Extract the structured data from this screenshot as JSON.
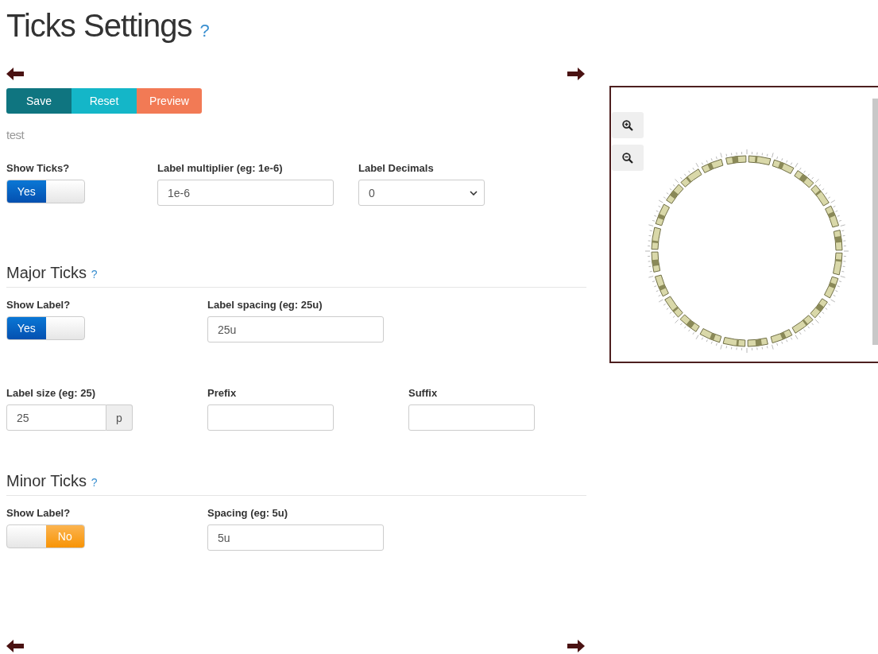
{
  "title": "Ticks Settings",
  "title_help": "?",
  "buttons": [
    {
      "label": "Save",
      "kind": "save"
    },
    {
      "label": "Reset",
      "kind": "reset"
    },
    {
      "label": "Preview",
      "kind": "preview"
    }
  ],
  "note": "test",
  "general": [
    {
      "kind": "toggle",
      "label": "Show Ticks?",
      "on": true,
      "text": "Yes"
    },
    {
      "kind": "input",
      "label": "Label multiplier (eg: 1e-6)",
      "value": "1e-6"
    },
    {
      "kind": "select",
      "label": "Label Decimals",
      "value": "0"
    }
  ],
  "sections": [
    {
      "heading": "Major Ticks",
      "help": "?",
      "rows": [
        [
          {
            "kind": "toggle",
            "label": "Show Label?",
            "on": true,
            "text": "Yes"
          },
          {
            "kind": "input",
            "label": "Label spacing (eg: 25u)",
            "value": "25u"
          }
        ],
        [
          {
            "kind": "addon",
            "label": "Label size (eg: 25)",
            "value": "25",
            "addon": "p"
          },
          {
            "kind": "input",
            "label": "Prefix"
          },
          {
            "kind": "input",
            "label": "Suffix"
          }
        ]
      ]
    },
    {
      "heading": "Minor Ticks",
      "help": "?",
      "rows": [
        [
          {
            "kind": "toggle",
            "label": "Show Label?",
            "on": false,
            "text": "No"
          },
          {
            "kind": "input",
            "label": "Spacing (eg: 5u)",
            "value": "5u"
          }
        ]
      ]
    }
  ]
}
